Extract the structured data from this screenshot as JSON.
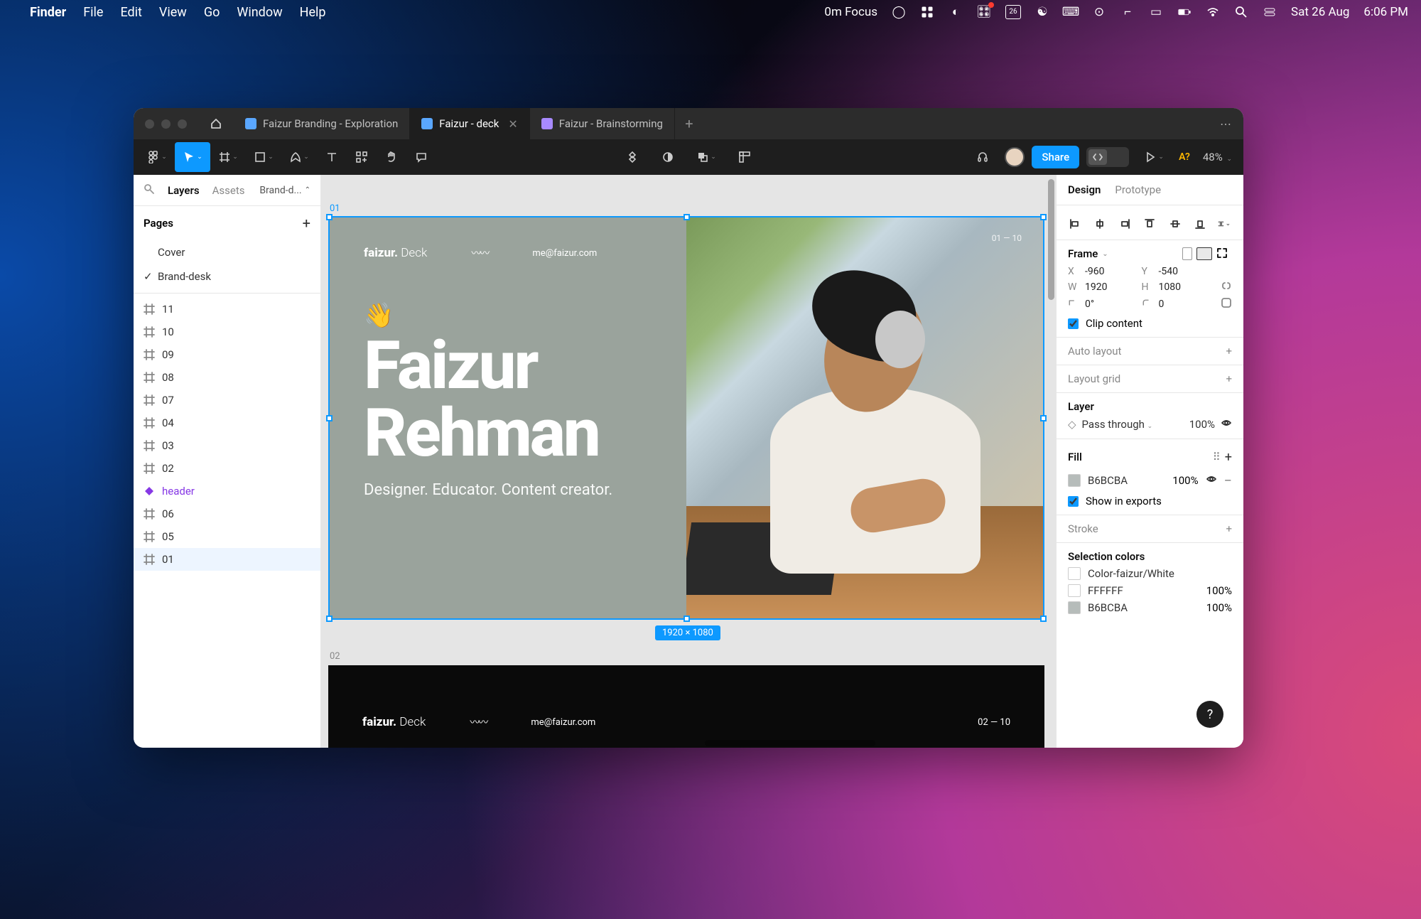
{
  "menubar": {
    "app": "Finder",
    "items": [
      "File",
      "Edit",
      "View",
      "Go",
      "Window",
      "Help"
    ],
    "focus": "0m Focus",
    "date": "Sat 26 Aug",
    "time": "6:06 PM",
    "cal_badge": "26"
  },
  "figma": {
    "tabs": [
      {
        "label": "Faizur Branding - Exploration",
        "color": "#5aa7ff"
      },
      {
        "label": "Faizur - deck",
        "color": "#5aa7ff",
        "active": true
      },
      {
        "label": "Faizur - Brainstorming",
        "color": "#a88aff"
      }
    ],
    "share": "Share",
    "a_badge": "A?",
    "zoom": "48%"
  },
  "left": {
    "tabs": {
      "layers": "Layers",
      "assets": "Assets",
      "dropdown": "Brand-d..."
    },
    "pages_title": "Pages",
    "pages": [
      "Cover",
      "Brand-desk"
    ],
    "active_page_index": 1,
    "layers": [
      {
        "name": "11",
        "type": "frame"
      },
      {
        "name": "10",
        "type": "frame"
      },
      {
        "name": "09",
        "type": "frame"
      },
      {
        "name": "08",
        "type": "frame"
      },
      {
        "name": "07",
        "type": "frame"
      },
      {
        "name": "04",
        "type": "frame"
      },
      {
        "name": "03",
        "type": "frame"
      },
      {
        "name": "02",
        "type": "frame"
      },
      {
        "name": "header",
        "type": "component"
      },
      {
        "name": "06",
        "type": "frame"
      },
      {
        "name": "05",
        "type": "frame"
      },
      {
        "name": "01",
        "type": "frame",
        "selected": true
      }
    ]
  },
  "canvas": {
    "frame1_id": "01",
    "frame2_id": "02",
    "brand_bold": "faizur.",
    "brand_light": "Deck",
    "email": "me@faizur.com",
    "pager": "01 — 10",
    "pager2": "02 — 10",
    "wave": "👋",
    "name1": "Faizur",
    "name2": "Rehman",
    "tagline": "Designer. Educator. Content creator.",
    "size_pill": "1920 × 1080"
  },
  "right": {
    "tabs": {
      "design": "Design",
      "prototype": "Prototype"
    },
    "frame_label": "Frame",
    "x": "-960",
    "y": "-540",
    "w": "1920",
    "h": "1080",
    "rotation": "0°",
    "corner": "0",
    "clip": "Clip content",
    "autolayout": "Auto layout",
    "layoutgrid": "Layout grid",
    "layer_title": "Layer",
    "blend": "Pass through",
    "opacity": "100%",
    "fill_title": "Fill",
    "fill_hex": "B6BCBA",
    "fill_opacity": "100%",
    "show_exports": "Show in exports",
    "stroke": "Stroke",
    "sel_colors_title": "Selection colors",
    "sel_colors": [
      {
        "name": "Color-faizur/White",
        "hex": null,
        "opacity": null,
        "swatch": "#ffffff"
      },
      {
        "name": "FFFFFF",
        "hex": "FFFFFF",
        "opacity": "100%",
        "swatch": "#ffffff"
      },
      {
        "name": "B6BCBA",
        "hex": "B6BCBA",
        "opacity": "100%",
        "swatch": "#b6bcba"
      }
    ],
    "help": "?"
  }
}
